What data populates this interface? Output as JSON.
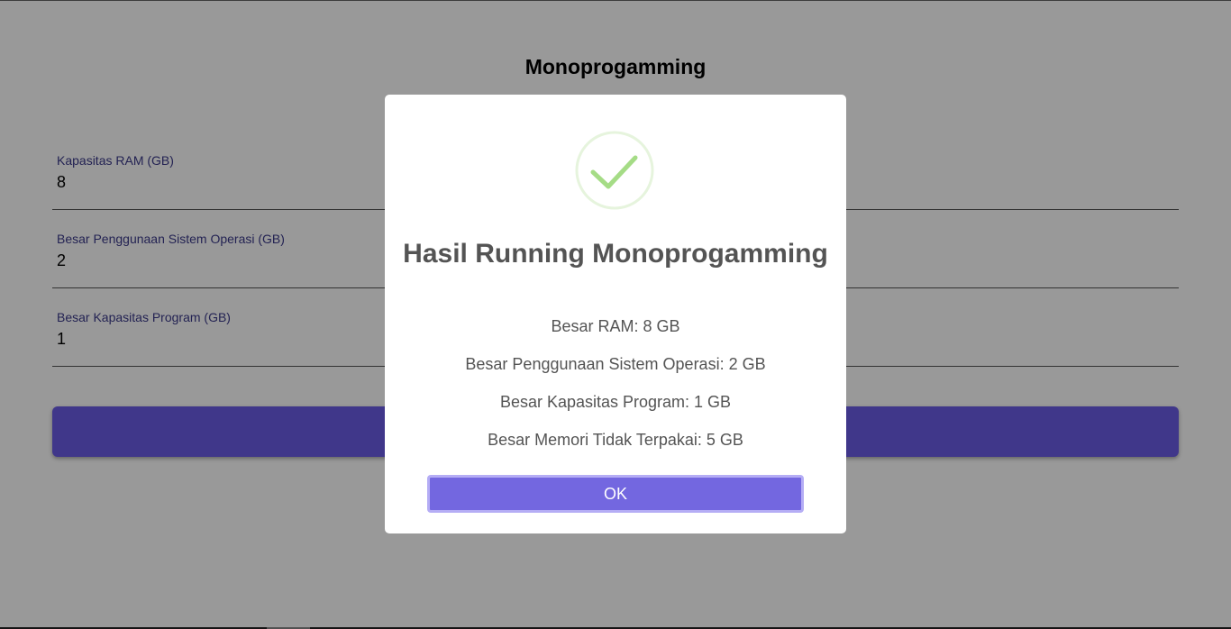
{
  "page": {
    "title": "Monoprogamming"
  },
  "form": {
    "fields": [
      {
        "label": "Kapasitas RAM (GB)",
        "value": "8"
      },
      {
        "label": "Besar Penggunaan Sistem Operasi (GB)",
        "value": "2"
      },
      {
        "label": "Besar Kapasitas Program (GB)",
        "value": "1"
      }
    ],
    "submit_label": ""
  },
  "modal": {
    "icon": "check-icon",
    "title": "Hasil Running Monoprogamming",
    "lines": [
      "Besar RAM: 8 GB",
      "Besar Penggunaan Sistem Operasi: 2 GB",
      "Besar Kapasitas Program: 1 GB",
      "Besar Memori Tidak Terpakai: 5 GB"
    ],
    "ok_label": "OK"
  },
  "colors": {
    "accent": "#7367e0",
    "success": "#a5dc86",
    "overlay": "rgba(0,0,0,0.4)"
  }
}
